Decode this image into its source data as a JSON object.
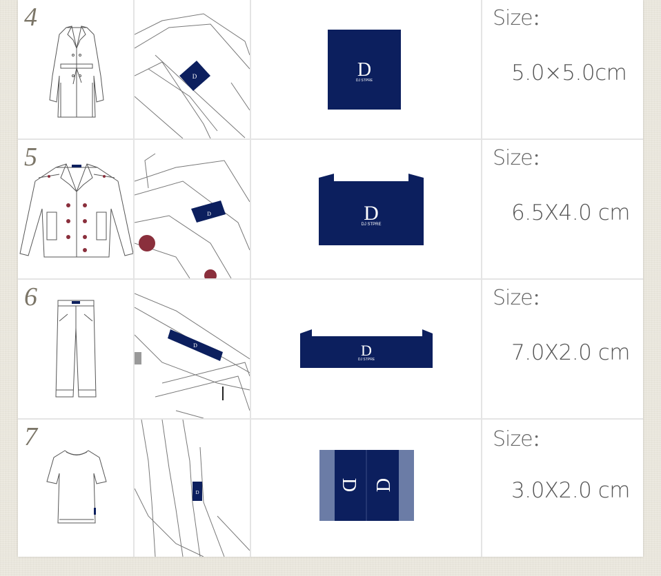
{
  "size_label": "Size",
  "size_colon": "：",
  "brand": "DJ STPRE",
  "rows": [
    {
      "number": "4",
      "item": "coat",
      "size": "5.0×5.0cm"
    },
    {
      "number": "5",
      "item": "jacket",
      "size": "6.5X4.0 cm"
    },
    {
      "number": "6",
      "item": "pants",
      "size": "7.0X2.0 cm"
    },
    {
      "number": "7",
      "item": "t-shirt",
      "size": "3.0X2.0 cm"
    }
  ],
  "colors": {
    "label_navy": "#0c1f5e",
    "label_light": "#6b7ca6",
    "text": "#555555",
    "number": "#7b7567"
  }
}
